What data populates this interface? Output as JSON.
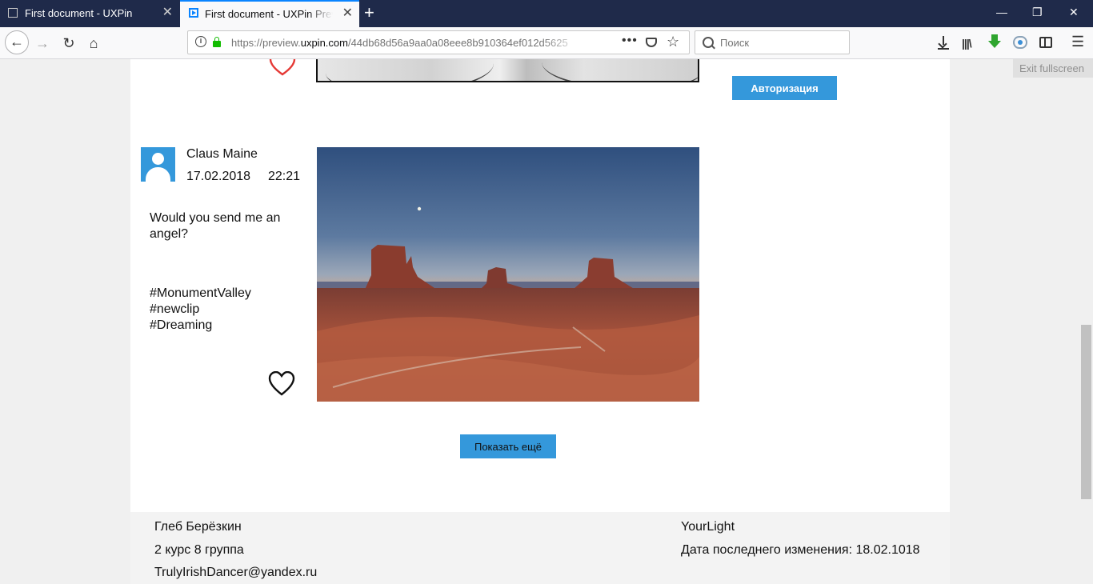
{
  "browser": {
    "tabs": [
      {
        "title": "First document - UXPin",
        "close": "✕"
      },
      {
        "title": "First document - UXPin Preview",
        "close": "✕"
      }
    ],
    "new_tab": "+",
    "window_controls": {
      "minimize": "—",
      "restore": "❐",
      "close": "✕"
    },
    "nav": {
      "back": "←",
      "forward": "→",
      "reload": "↻",
      "home": "⌂"
    },
    "url": {
      "prefix": "https://preview.",
      "host": "uxpin.com",
      "path": "/44db68d56a9aa0a08eee8b910364ef012d5625"
    },
    "url_more": "•••",
    "bookmark_star": "☆",
    "search_placeholder": "Поиск",
    "library_icon": "|||\\",
    "menu_icon": "☰",
    "exit_fullscreen": "Exit fullscreen"
  },
  "sidebar": {
    "auth_button": "Авторизация"
  },
  "post": {
    "author": "Claus Maine",
    "date": "17.02.2018",
    "time": "22:21",
    "text": "Would you send me an angel?",
    "tags": [
      "#MonumentValley",
      "#newclip",
      "#Dreaming"
    ],
    "liked": false,
    "photo_icon": "monument-valley-photo"
  },
  "previous_post": {
    "liked": true,
    "heart_color": "#e53935"
  },
  "show_more": "Показать ещё",
  "footer": {
    "left": [
      "Глеб Берёзкин",
      "2 курс 8 группа",
      "TrulyIrishDancer@yandex.ru"
    ],
    "right": [
      "YourLight",
      "Дата последнего изменения: 18.02.1018"
    ]
  },
  "colors": {
    "accent": "#3498db",
    "tabbar": "#1f2a4a"
  }
}
